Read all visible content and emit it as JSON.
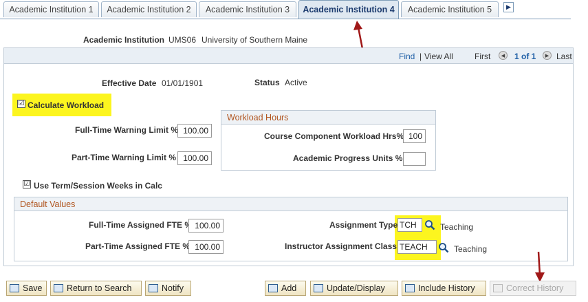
{
  "tabs": [
    {
      "label": "Academic Institution 1"
    },
    {
      "label": "Academic Institution 2"
    },
    {
      "label": "Academic Institution 3"
    },
    {
      "label": "Academic Institution 4",
      "active": true
    },
    {
      "label": "Academic Institution 5"
    }
  ],
  "header": {
    "institution_label": "Academic Institution",
    "institution_code": "UMS06",
    "institution_name": "University of Southern Maine"
  },
  "nav": {
    "find": "Find",
    "separator": "|",
    "view_all": "View All",
    "first": "First",
    "count": "1 of 1",
    "last": "Last"
  },
  "record": {
    "effective_date_label": "Effective Date",
    "effective_date": "01/01/1901",
    "status_label": "Status",
    "status": "Active",
    "calculate_workload_label": "Calculate Workload",
    "calculate_workload_checked": "☑",
    "full_time_warning_label": "Full-Time Warning Limit %",
    "full_time_warning": "100.00",
    "part_time_warning_label": "Part-Time Warning Limit %",
    "part_time_warning": "100.00",
    "use_term_weeks_label": "Use Term/Session Weeks in Calc",
    "use_term_weeks_checked": "☑"
  },
  "workload_hours": {
    "title": "Workload Hours",
    "course_component_label": "Course Component Workload Hrs%",
    "course_component": "100",
    "academic_progress_label": "Academic Progress Units %",
    "academic_progress": ""
  },
  "default_values": {
    "title": "Default Values",
    "full_time_fte_label": "Full-Time Assigned FTE %",
    "full_time_fte": "100.00",
    "part_time_fte_label": "Part-Time Assigned FTE %",
    "part_time_fte": "100.00",
    "assignment_type_label": "Assignment Type",
    "assignment_type": "TCH",
    "assignment_type_desc": "Teaching",
    "instructor_class_label": "Instructor Assignment Class",
    "instructor_class": "TEACH",
    "instructor_class_desc": "Teaching"
  },
  "toolbar": {
    "save": "Save",
    "return_to_search": "Return to Search",
    "notify": "Notify",
    "add": "Add",
    "update_display": "Update/Display",
    "include_history": "Include History",
    "correct_history": "Correct History"
  },
  "colors": {
    "highlight": "#fcf51f",
    "annotation_arrow": "#a01818",
    "group_title": "#b0541e",
    "link": "#1f5fa6"
  },
  "icons": {
    "tab_next": "next-tab-arrow-icon",
    "lookup": "magnifier-icon",
    "arrows": "annotation-arrow-icon"
  }
}
